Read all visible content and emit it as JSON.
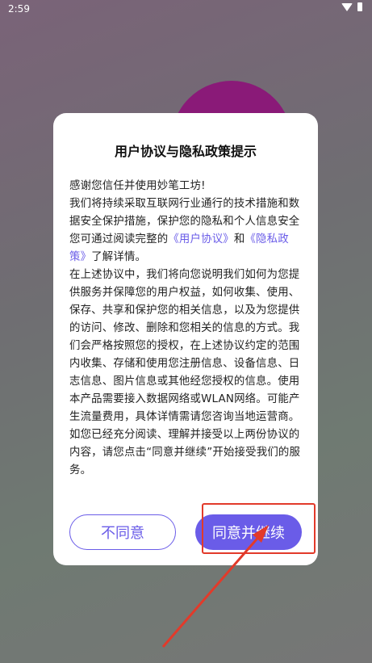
{
  "status_bar": {
    "time": "2:59",
    "icons": [
      "wifi-icon",
      "battery-icon"
    ]
  },
  "dialog": {
    "title": "用户协议与隐私政策提示",
    "body": {
      "p1_intro": "感谢您信任并使用妙笔工坊!",
      "p1_text": "我们将持续采取互联网行业通行的技术措施和数据安全保护措施，保护您的隐私和个人信息安全您可通过阅读完整的",
      "link_user_agreement": "《用户协议》",
      "and": "和",
      "link_privacy_policy": "《隐私政策》",
      "p1_end": "了解详情。",
      "p2": "在上述协议中，我们将向您说明我们如何为您提供服务并保障您的用户权益，如何收集、使用、保存、共享和保护您的相关信息，以及为您提供的访问、修改、删除和您相关的信息的方式。我们会严格按照您的授权，在上述协议约定的范围内收集、存储和使用您注册信息、设备信息、日志信息、图片信息或其他经您授权的信息。使用本产品需要接入数据网络或WLAN网络。可能产生流量费用，具体详情需请您咨询当地运营商。如您已经充分阅读、理解并接受以上两份协议的内容，请您点击“同意并继续”开始接受我们的服务。"
    },
    "buttons": {
      "decline": "不同意",
      "agree": "同意并继续"
    }
  },
  "colors": {
    "accent": "#6a5ce8",
    "annotation": "#e23a2a",
    "background_circle": "#8a1a78"
  }
}
